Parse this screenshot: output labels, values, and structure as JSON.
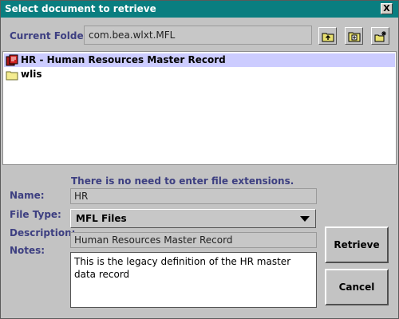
{
  "window": {
    "title": "Select document to retrieve",
    "close_label": "X"
  },
  "folder": {
    "label": "Current Folder:",
    "value": "com.bea.wlxt.MFL",
    "toolbar": [
      {
        "icon": "folder-up-icon"
      },
      {
        "icon": "folder-home-icon"
      },
      {
        "icon": "new-folder-icon"
      }
    ]
  },
  "files": [
    {
      "name": "HR - Human Resources Master Record",
      "icon": "document-icon",
      "selected": true
    },
    {
      "name": "wlis",
      "icon": "folder-icon",
      "selected": false
    }
  ],
  "form": {
    "hint": "There is no need to enter file extensions.",
    "name_label": "Name:",
    "name_value": "HR",
    "filetype_label": "File Type:",
    "filetype_value": "MFL Files",
    "description_label": "Description:",
    "description_value": "Human Resources Master Record",
    "notes_label": "Notes:",
    "notes_value": "This is the legacy definition of the HR master data record"
  },
  "buttons": {
    "retrieve": "Retrieve",
    "cancel": "Cancel"
  },
  "colors": {
    "titlebar": "#0a7e80",
    "label_blue": "#3d3f81",
    "selection": "#ccccff",
    "window_bg": "#c3c3c3"
  }
}
